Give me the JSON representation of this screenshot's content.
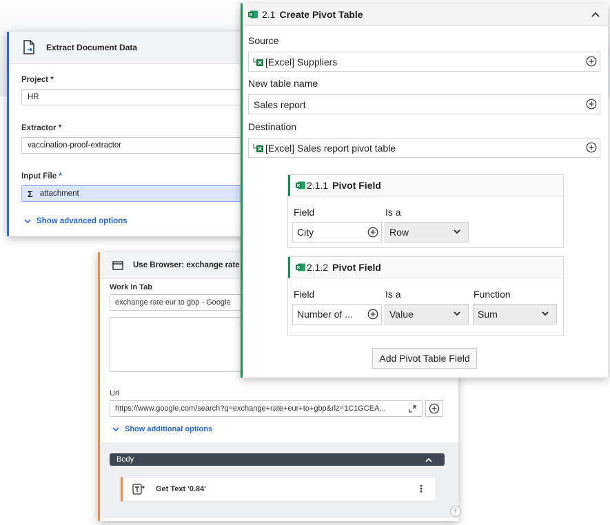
{
  "extract": {
    "title": "Extract Document Data",
    "project_label": "Project",
    "project_value": "HR",
    "extractor_label": "Extractor",
    "extractor_value": "vaccination-proof-extractor",
    "input_label": "Input File",
    "required_mark": "*",
    "input_symbol": "Σ",
    "input_value": "attachment",
    "advanced_label": "Show advanced options"
  },
  "browser": {
    "title": "Use Browser: exchange rate",
    "work_in_tab_label": "Work in Tab",
    "work_in_tab_value": "exchange rate eur to gbp - Google",
    "url_label": "Url",
    "url_value": "https://www.google.com/search?q=exchange+rate+eur+to+gbp&rlz=1C1GCEA...",
    "additional_label": "Show additional options",
    "body_label": "Body",
    "activity_label": "Get Text '0.84'"
  },
  "pivot": {
    "number": "2.1",
    "title": "Create Pivot Table",
    "source_label": "Source",
    "source_value": "[Excel] Suppliers",
    "new_table_label": "New table name",
    "new_table_value": "Sales report",
    "destination_label": "Destination",
    "destination_value": "[Excel] Sales report pivot table",
    "fields": [
      {
        "number": "2.1.1",
        "title": "Pivot Field",
        "field_label": "Field",
        "isa_label": "Is a",
        "field_value": "City",
        "isa_value": "Row"
      },
      {
        "number": "2.1.2",
        "title": "Pivot Field",
        "field_label": "Field",
        "isa_label": "Is a",
        "function_label": "Function",
        "field_value": "Number of ...",
        "isa_value": "Value",
        "function_value": "Sum"
      }
    ],
    "add_button": "Add Pivot Table Field"
  },
  "colors": {
    "extract_accent": "#2e6bd8",
    "browser_accent": "#f08a4b",
    "pivot_accent": "#1c8b4f",
    "link": "#2469d8"
  },
  "icons": [
    "document-icon",
    "browser-window-icon",
    "excel-icon",
    "plus-circle-icon",
    "chevron-up-icon",
    "chevron-down-icon",
    "expand-icon",
    "get-text-icon",
    "kebab-icon",
    "scroll-top-icon"
  ]
}
